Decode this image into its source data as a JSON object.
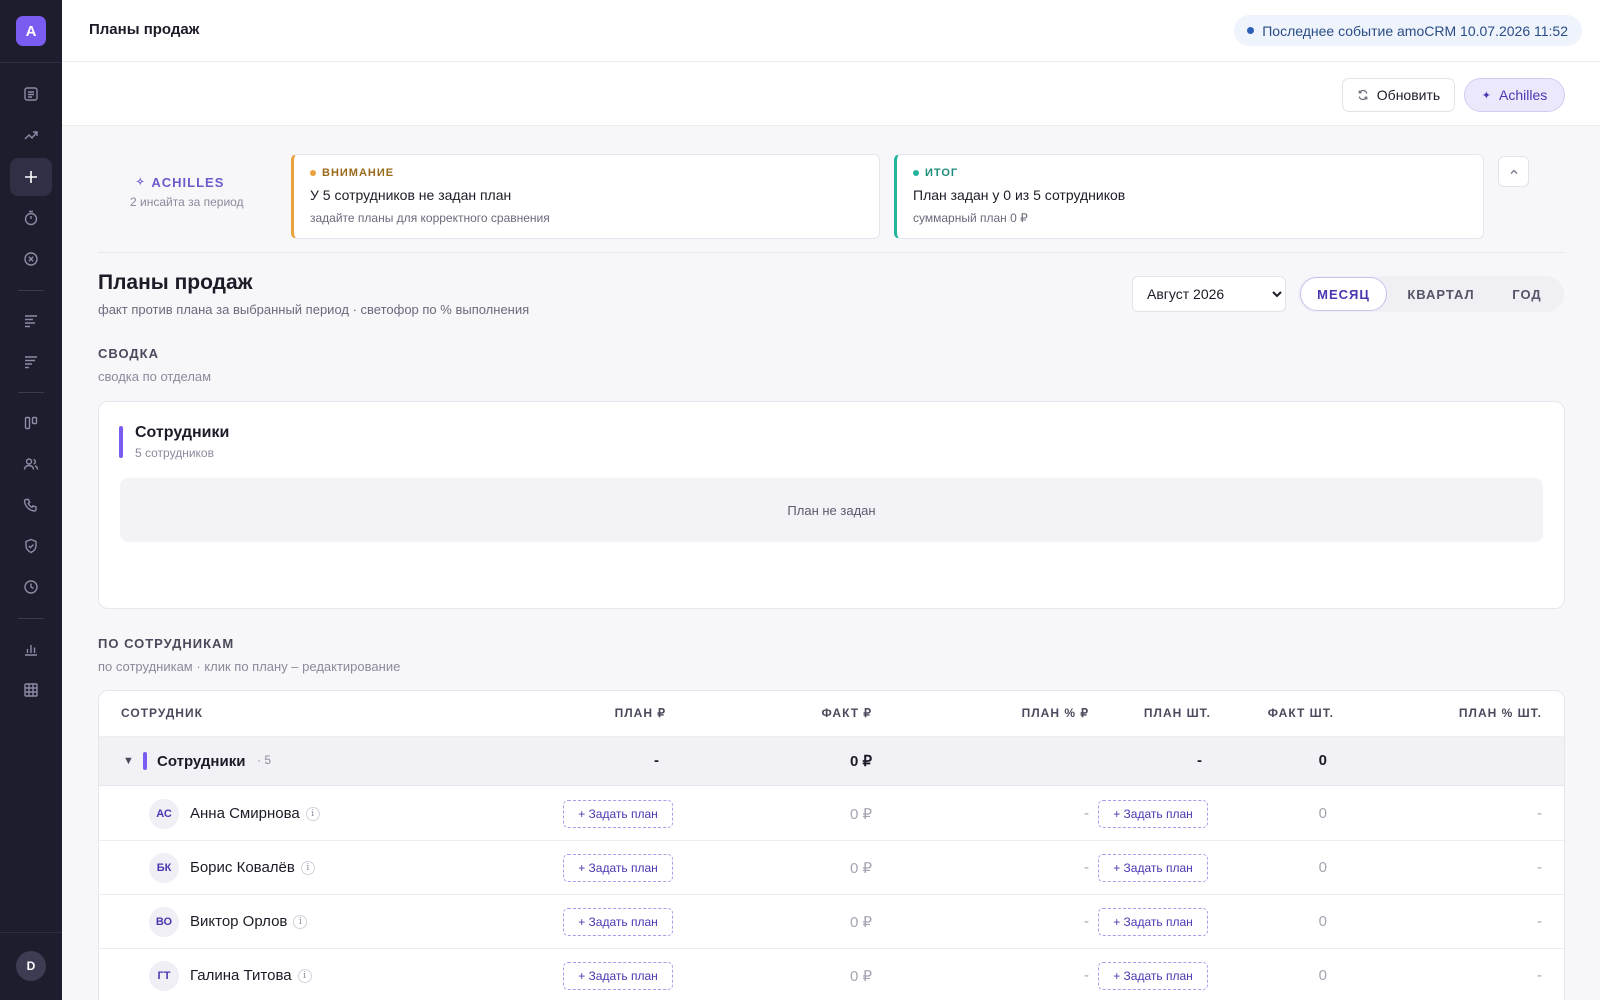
{
  "sidebar": {
    "logo": "A",
    "user_initial": "D",
    "items": [
      {
        "icon": "list-icon"
      },
      {
        "icon": "trending-up-icon"
      },
      {
        "icon": "plus-icon",
        "active": true
      },
      {
        "icon": "timer-icon"
      },
      {
        "icon": "close-circle-icon"
      },
      {
        "icon": "bars-icon"
      },
      {
        "icon": "bars-icon"
      },
      {
        "icon": "kanban-icon"
      },
      {
        "icon": "users-icon"
      },
      {
        "icon": "phone-icon"
      },
      {
        "icon": "shield-check-icon"
      },
      {
        "icon": "clock-icon"
      },
      {
        "icon": "bar-chart-icon"
      },
      {
        "icon": "grid-icon"
      }
    ]
  },
  "header": {
    "title": "Планы продаж",
    "event": "Последнее событие amoCRM 10.07.2026 11:52"
  },
  "toolbar": {
    "refresh_label": "Обновить",
    "achilles_label": "Achilles"
  },
  "insights": {
    "title": "ACHILLES",
    "subtitle": "2 инсайта за период",
    "cards": [
      {
        "tag": "ВНИМАНИЕ",
        "text": "У 5 сотрудников не задан план",
        "note": "задайте планы для корректного сравнения"
      },
      {
        "tag": "ИТОГ",
        "text": "План задан у 0 из 5 сотрудников",
        "note": "суммарный план 0 ₽"
      }
    ]
  },
  "page": {
    "title": "Планы продаж",
    "subtitle": "факт против плана за выбранный период · светофор по % выполнения",
    "period": "Август 2026",
    "tabs": [
      "МЕСЯЦ",
      "КВАРТАЛ",
      "ГОД"
    ],
    "active_tab": "МЕСЯЦ"
  },
  "summary": {
    "label": "СВОДКА",
    "sublabel": "сводка по отделам",
    "dept_name": "Сотрудники",
    "dept_count": "5 сотрудников",
    "empty": "План не задан"
  },
  "by_employee": {
    "label": "ПО СОТРУДНИКАМ",
    "sublabel": "по сотрудникам · клик по плану – редактирование",
    "columns": [
      "СОТРУДНИК",
      "ПЛАН ₽",
      "ФАКТ ₽",
      "ПЛАН % ₽",
      "ПЛАН ШТ.",
      "ФАКТ ШТ.",
      "ПЛАН % ШТ."
    ],
    "group": {
      "name": "Сотрудники",
      "count": "· 5",
      "plan_rub": "-",
      "fact_rub": "0 ₽",
      "plan_pcs": "-",
      "fact_pcs": "0"
    },
    "set_plan_label": "+ Задать план",
    "rows": [
      {
        "initials": "АС",
        "name": "Анна Смирнова",
        "fact_rub": "0 ₽",
        "plan_pct_rub": "-",
        "fact_pcs": "0",
        "plan_pct_pcs": "-"
      },
      {
        "initials": "БК",
        "name": "Борис Ковалёв",
        "fact_rub": "0 ₽",
        "plan_pct_rub": "-",
        "fact_pcs": "0",
        "plan_pct_pcs": "-"
      },
      {
        "initials": "ВО",
        "name": "Виктор Орлов",
        "fact_rub": "0 ₽",
        "plan_pct_rub": "-",
        "fact_pcs": "0",
        "plan_pct_pcs": "-"
      },
      {
        "initials": "ГТ",
        "name": "Галина Титова",
        "fact_rub": "0 ₽",
        "plan_pct_rub": "-",
        "fact_pcs": "0",
        "plan_pct_pcs": "-"
      }
    ]
  },
  "colors": {
    "accent": "#7b5cf0",
    "sidebar": "#1d1d2d",
    "warning": "#e9a23b",
    "success": "#22b59b"
  }
}
